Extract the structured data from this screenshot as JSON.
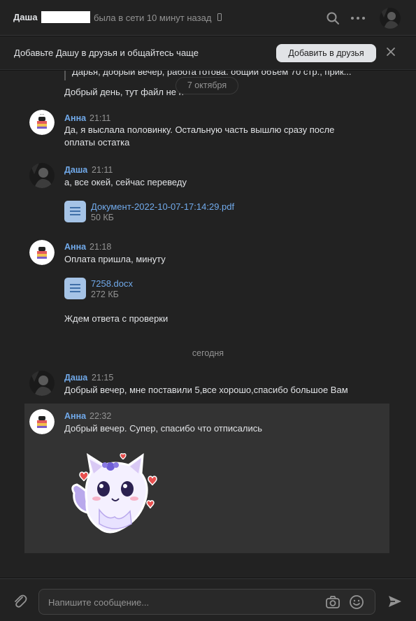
{
  "header": {
    "name": "Даша",
    "status": "была в сети 10 минут назад",
    "search_icon": "search-icon",
    "more_icon": "more-icon"
  },
  "friend_bar": {
    "text": "Добавьте Дашу в друзья и общайтесь чаще",
    "button": "Добавить в друзья",
    "close_icon": "close-icon"
  },
  "history": {
    "quote": "Дарья, добрый вечер, работа готова. общий объем 70 стр., прик...",
    "partial_message": "Добрый день, тут файл не п",
    "date_pill": "7 октября"
  },
  "messages": [
    {
      "author": "Анна",
      "time": "21:11",
      "lines": [
        "Да, я выслала половинку. Остальную часть вышлю сразу после",
        "оплаты остатка"
      ]
    },
    {
      "author": "Даша",
      "time": "21:11",
      "lines": [
        "а, все окей, сейчас переведу"
      ],
      "doc": {
        "name": "Документ-2022-10-07-17:14:29.pdf",
        "size": "50 КБ"
      }
    },
    {
      "author": "Анна",
      "time": "21:18",
      "lines": [
        "Оплата пришла, минуту"
      ],
      "doc": {
        "name": "7258.docx",
        "size": "272 КБ"
      },
      "extra": "Ждем ответа с проверки"
    }
  ],
  "today_label": "сегодня",
  "today_messages": [
    {
      "author": "Даша",
      "time": "21:15",
      "text": "Добрый вечер, мне поставили 5,все хорошо,спасибо большое Вам"
    },
    {
      "author": "Анна",
      "time": "22:32",
      "text": "Добрый вечер. Супер, спасибо что отписались"
    }
  ],
  "composer": {
    "placeholder": "Напишите сообщение..."
  },
  "colors": {
    "accent_link": "#71aaeb",
    "background": "#222222",
    "highlight": "#333333",
    "muted": "#939393"
  }
}
